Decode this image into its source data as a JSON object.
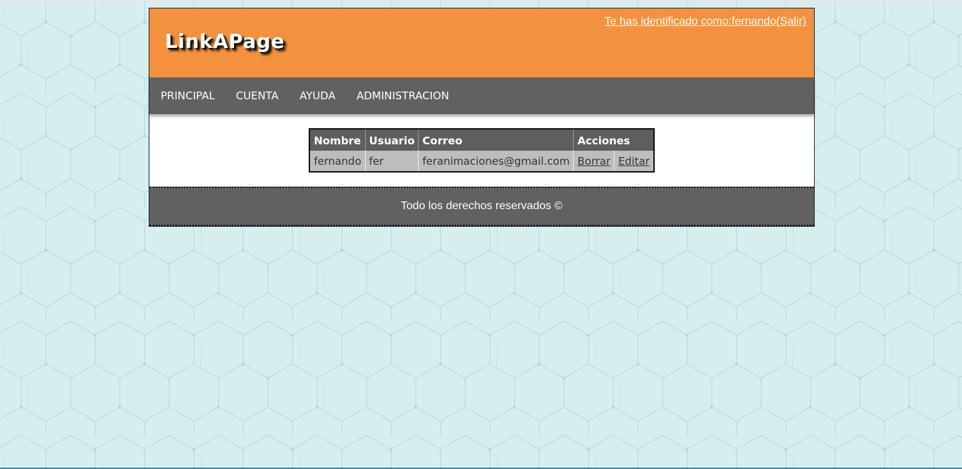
{
  "header": {
    "logo": "LinkAPage",
    "session_link": "Te has identificado como:fernando(Salir)"
  },
  "nav": {
    "items": [
      {
        "label": "PRINCIPAL"
      },
      {
        "label": "CUENTA"
      },
      {
        "label": "AYUDA"
      },
      {
        "label": "ADMINISTRACION"
      }
    ]
  },
  "table": {
    "headers": [
      "Nombre",
      "Usuario",
      "Correo",
      "Acciones"
    ],
    "rows": [
      {
        "nombre": "fernando",
        "usuario": "fer",
        "correo": "feranimaciones@gmail.com",
        "actions": [
          "Borrar",
          "Editar"
        ]
      }
    ]
  },
  "footer": {
    "text": "Todo los derechos reservados ©"
  },
  "colors": {
    "header_bg": "#f4913e",
    "nav_bg": "#616161",
    "page_bg": "#d6eeef",
    "table_header_bg": "#5e5e5e",
    "table_cell_bg": "#bdbdbd"
  }
}
